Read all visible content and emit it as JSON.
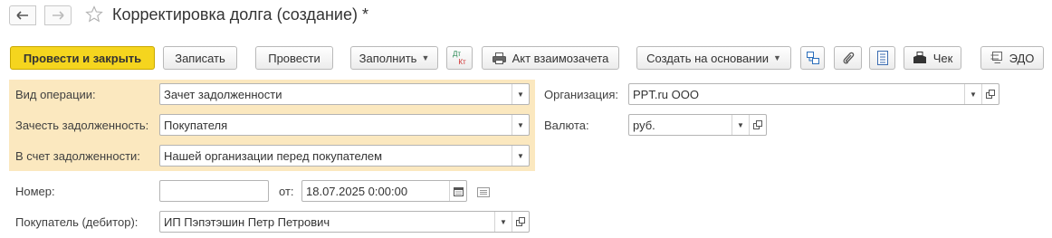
{
  "window": {
    "title": "Корректировка долга (создание) *"
  },
  "toolbar": {
    "post_close": "Провести и закрыть",
    "write": "Записать",
    "post": "Провести",
    "fill": "Заполнить",
    "dt_kt_top": "Дт",
    "dt_kt_bottom": "Кт",
    "act": "Акт взаимозачета",
    "create_based": "Создать на основании",
    "check": "Чек",
    "edo": "ЭДО"
  },
  "form": {
    "operation_type": {
      "label": "Вид операции:",
      "value": "Зачет задолженности"
    },
    "offset_debt": {
      "label": "Зачесть задолженность:",
      "value": "Покупателя"
    },
    "to_debt": {
      "label": "В счет задолженности:",
      "value": "Нашей организации перед покупателем"
    },
    "number": {
      "label": "Номер:",
      "value": ""
    },
    "date": {
      "label": "от:",
      "value": "18.07.2025  0:00:00"
    },
    "buyer": {
      "label": "Покупатель (дебитор):",
      "value": "ИП Пэпэтэшин Петр Петрович"
    },
    "organization": {
      "label": "Организация:",
      "value": "PPT.ru ООО"
    },
    "currency": {
      "label": "Валюта:",
      "value": "руб."
    }
  },
  "colors": {
    "primary_button": "#f5d51e",
    "highlight_bg": "#fbe8bf",
    "dt_color": "#2e8b57",
    "kt_color": "#d03030"
  }
}
